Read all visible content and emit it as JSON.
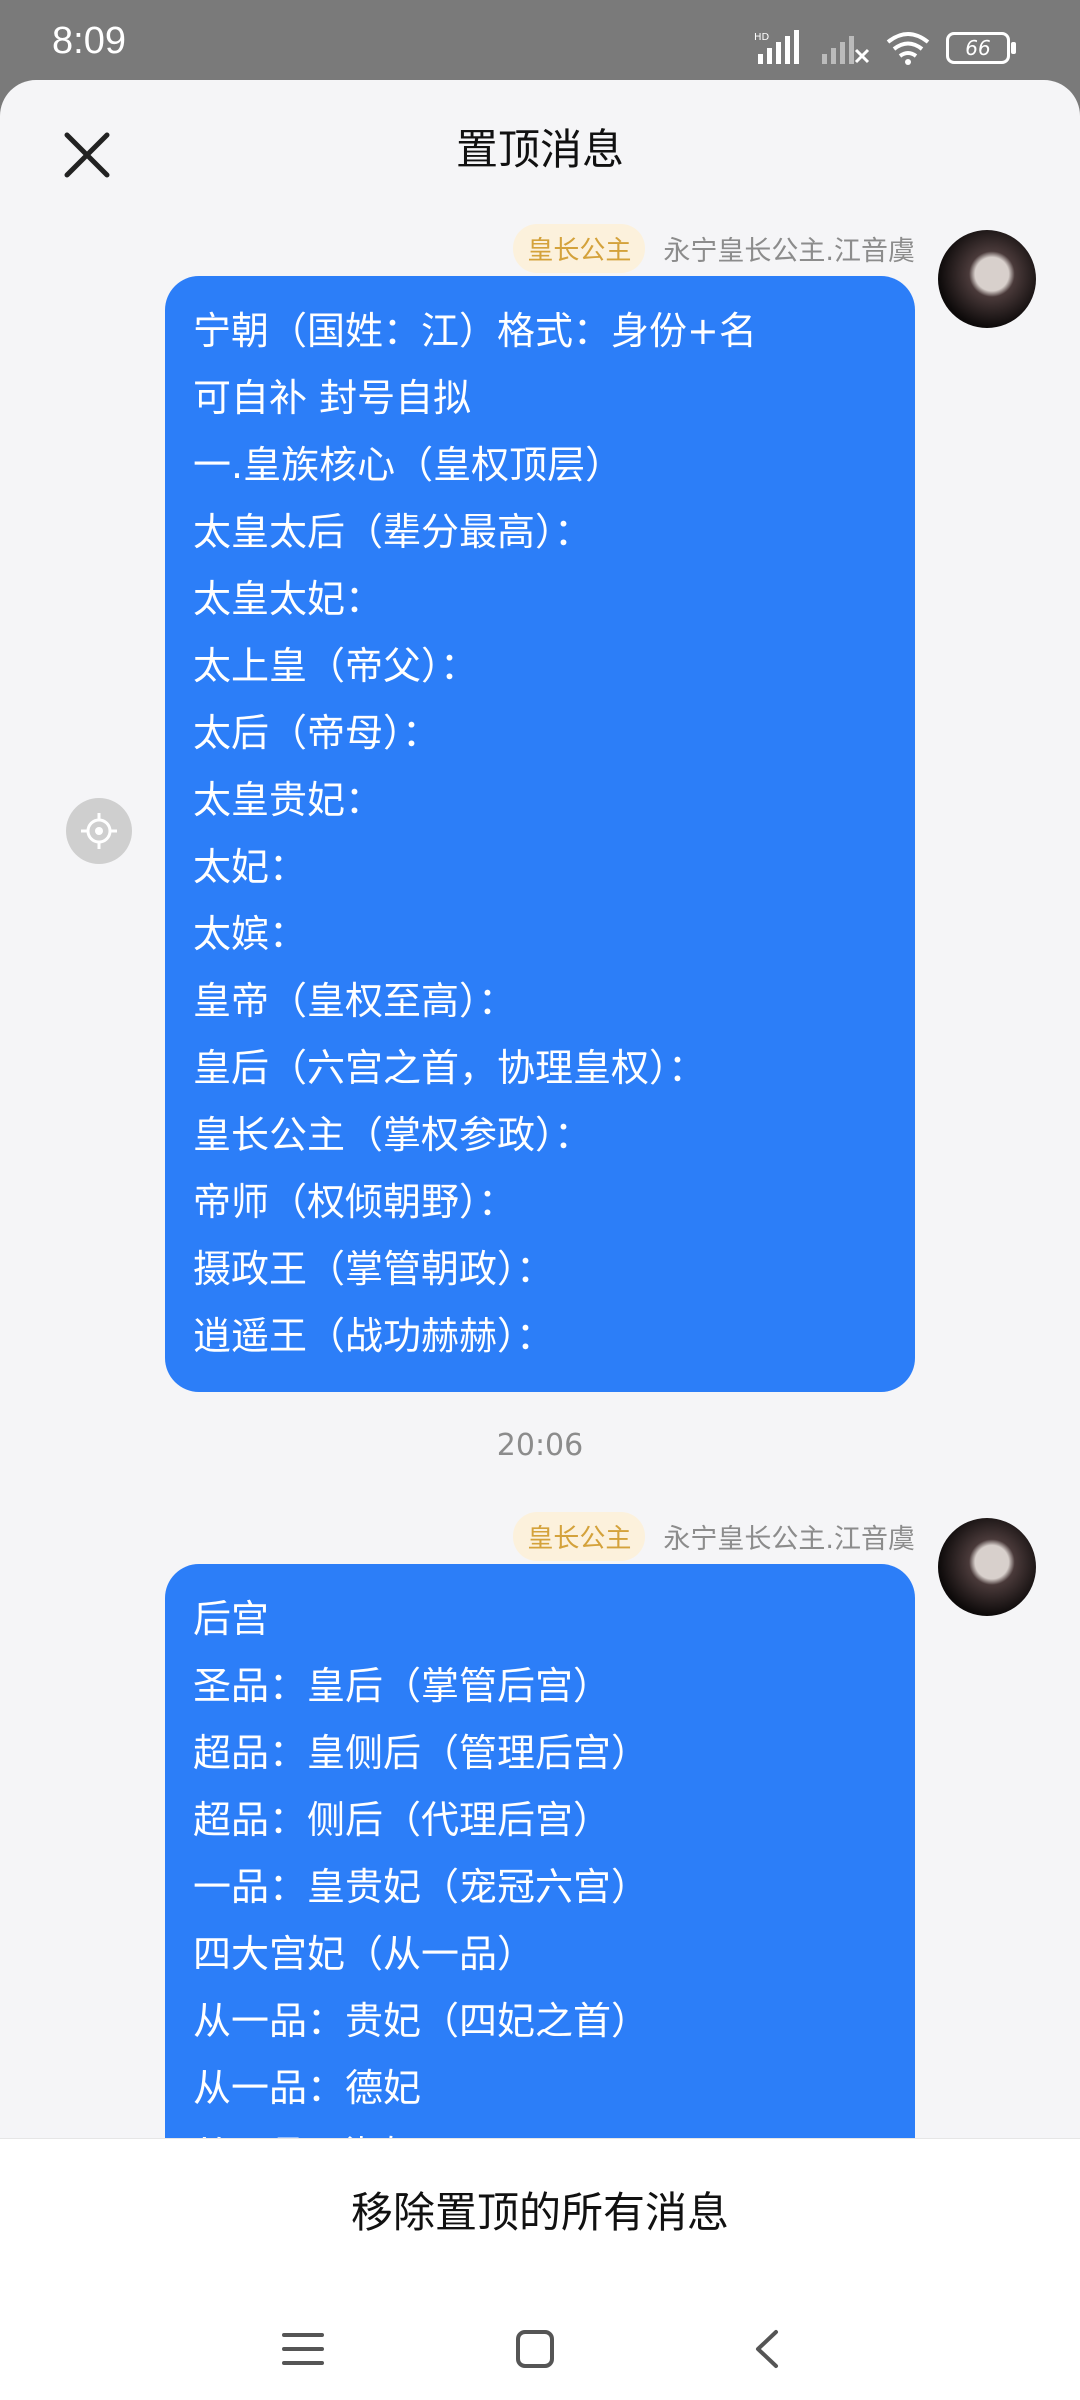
{
  "status_bar": {
    "time": "8:09",
    "battery": "66"
  },
  "header": {
    "title": "置顶消息"
  },
  "messages": [
    {
      "badge": "皇长公主",
      "sender": "永宁皇长公主.江音虞",
      "lines": [
        "宁朝（国姓：江）格式：身份+名",
        "可自补 封号自拟",
        "一.皇族核心（皇权顶层）",
        "太皇太后（辈分最高）：",
        "太皇太妃：",
        "太上皇（帝父）：",
        "太后（帝母）：",
        "太皇贵妃：",
        "太妃：",
        "太嫔：",
        "皇帝（皇权至高）：",
        "皇后（六宫之首，协理皇权）：",
        "皇长公主（掌权参政）：",
        "帝师（权倾朝野）：",
        "摄政王（掌管朝政）：",
        "逍遥王（战功赫赫）："
      ]
    },
    {
      "badge": "皇长公主",
      "sender": "永宁皇长公主.江音虞",
      "lines": [
        "后宫",
        "圣品：皇后（掌管后宫）",
        "超品：皇侧后（管理后宫）",
        "超品：侧后（代理后宫）",
        "一品：皇贵妃（宠冠六宫）",
        "四大宫妃（从一品）",
        "从一品：贵妃（四妃之首）",
        "从一品：德妃",
        "从一品：淑妃"
      ]
    }
  ],
  "time_separator": "20:06",
  "footer": {
    "remove_all": "移除置顶的所有消息"
  },
  "icons": {
    "close": "close-icon",
    "locate": "locate-icon",
    "nav_menu": "menu-icon",
    "nav_home": "home-icon",
    "nav_back": "back-icon"
  },
  "colors": {
    "bubble": "#2c7ef8",
    "badge_text": "#d4a23b",
    "badge_bg": "#fcf1dc"
  }
}
